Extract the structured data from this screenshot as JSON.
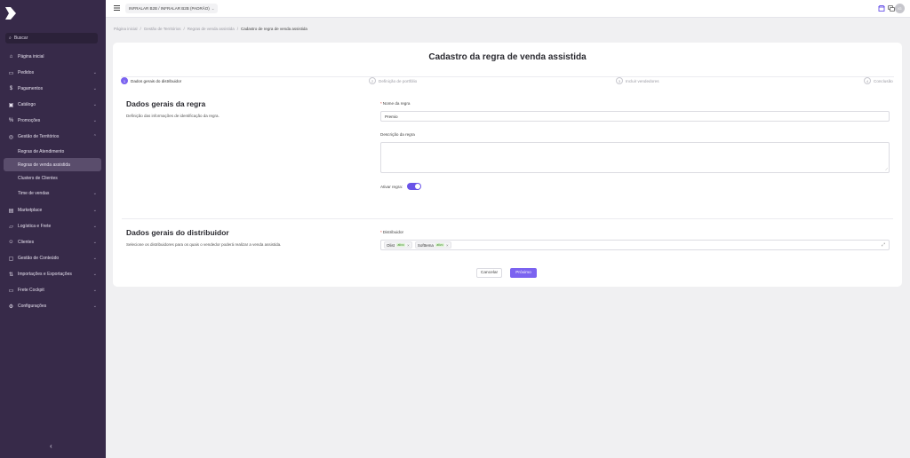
{
  "sidebar": {
    "search_label": "Buscar",
    "items": [
      {
        "label": "Página inicial",
        "icon": "home-icon"
      },
      {
        "label": "Pedidos",
        "icon": "cart-icon"
      },
      {
        "label": "Pagamentos",
        "icon": "dollar-icon"
      },
      {
        "label": "Catálogo",
        "icon": "catalog-icon"
      },
      {
        "label": "Promoções",
        "icon": "percent-icon"
      },
      {
        "label": "Gestão de Territórios",
        "icon": "location-icon"
      },
      {
        "label": "Marketplace",
        "icon": "marketplace-icon"
      },
      {
        "label": "Logística e Frete",
        "icon": "truck-icon"
      },
      {
        "label": "Clientes",
        "icon": "users-icon"
      },
      {
        "label": "Gestão de Conteúdo",
        "icon": "content-icon"
      },
      {
        "label": "Importações e Exportações",
        "icon": "import-export-icon"
      },
      {
        "label": "Frete Cockpit",
        "icon": "cockpit-icon"
      },
      {
        "label": "Configurações",
        "icon": "gear-icon"
      }
    ],
    "subitems": [
      {
        "label": "Regras de Atendimento"
      },
      {
        "label": "Regras de venda assistida"
      },
      {
        "label": "Clusters de Clientes"
      },
      {
        "label": "Time de vendas"
      }
    ]
  },
  "topbar": {
    "company": "INFRALAR B2B / INFRALAR B2B (PADRÃO)",
    "avatar_initials": "IG"
  },
  "breadcrumb": [
    "Página inicial",
    "Gestão de Territórios",
    "Regras de venda assistida",
    "Cadastro de regra de venda assistida"
  ],
  "page": {
    "title": "Cadastro da regra de venda assistida",
    "steps": [
      {
        "number": "1",
        "label": "Dados gerais do distribuidor"
      },
      {
        "number": "2",
        "label": "Definição de portfólio"
      },
      {
        "number": "3",
        "label": "Incluir vendedores"
      },
      {
        "number": "4",
        "label": "Conclusão"
      }
    ],
    "section1": {
      "title": "Dados gerais da regra",
      "desc": "Definição das informações de identificação da regra.",
      "name_label": "Nome da regra",
      "name_value": "Premio",
      "desc_label": "Descrição da regra",
      "active_label": "Ativar regra:"
    },
    "section2": {
      "title": "Dados gerais do distribuidor",
      "desc": "Selecione os distribuidores para os quais o vendedor poderá realizar a venda assistida.",
      "dist_label": "Distribuidor",
      "tags": [
        {
          "label": "Olist",
          "badge": "ativo"
        },
        {
          "label": "Softtema",
          "badge": "ativo"
        }
      ]
    },
    "cancel_label": "Cancelar",
    "next_label": "Próximo"
  }
}
